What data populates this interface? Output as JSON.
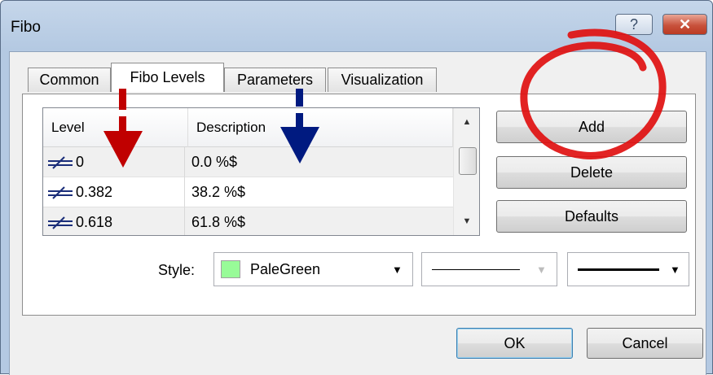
{
  "window": {
    "title": "Fibo",
    "help_glyph": "?",
    "close_glyph": "✕"
  },
  "tabs": [
    {
      "label": "Common",
      "active": false
    },
    {
      "label": "Fibo Levels",
      "active": true
    },
    {
      "label": "Parameters",
      "active": false
    },
    {
      "label": "Visualization",
      "active": false
    }
  ],
  "levels_list": {
    "columns": [
      "Level",
      "Description"
    ],
    "rows": [
      {
        "level": "0",
        "description": "0.0  %$"
      },
      {
        "level": "0.382",
        "description": "38.2  %$"
      },
      {
        "level": "0.618",
        "description": "61.8  %$"
      }
    ],
    "row_icon": "strikethrough-level-icon"
  },
  "buttons": {
    "add": "Add",
    "delete": "Delete",
    "defaults": "Defaults",
    "ok": "OK",
    "cancel": "Cancel"
  },
  "style": {
    "label": "Style:",
    "color_name": "PaleGreen",
    "color_hex": "#98fb98",
    "line_style": "solid",
    "line_width": "thick"
  },
  "annotations": {
    "red_arrow_color": "#c00000",
    "blue_arrow_color": "#001a80",
    "circle_color": "#e01010"
  }
}
